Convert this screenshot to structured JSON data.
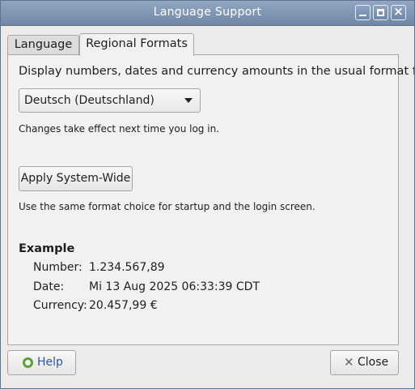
{
  "window": {
    "title": "Language Support",
    "controls": {
      "minimize": "minimize-icon",
      "maximize": "maximize-icon",
      "close": "×"
    }
  },
  "tabs": [
    {
      "label": "Language",
      "active": false
    },
    {
      "label": "Regional Formats",
      "active": true
    }
  ],
  "regional": {
    "description": "Display numbers, dates and currency amounts in the usual format for:",
    "selected_format": "Deutsch (Deutschland)",
    "change_note": "Changes take effect next time you log in.",
    "apply_button": "Apply System-Wide",
    "apply_note": "Use the same format choice for startup and the login screen."
  },
  "example": {
    "heading": "Example",
    "number_label": "Number:",
    "number_value": "1.234.567,89",
    "date_label": "Date:",
    "date_value": "Mi 13 Aug 2025 06:33:39 CDT",
    "currency_label": "Currency:",
    "currency_value": "20.457,99 €"
  },
  "footer": {
    "help_label": "Help",
    "close_label": "Close",
    "close_icon_glyph": "✕"
  },
  "colors": {
    "titlebar": "#7f95b4",
    "link_blue": "#2d55a6",
    "help_icon": "#5aa03a"
  }
}
